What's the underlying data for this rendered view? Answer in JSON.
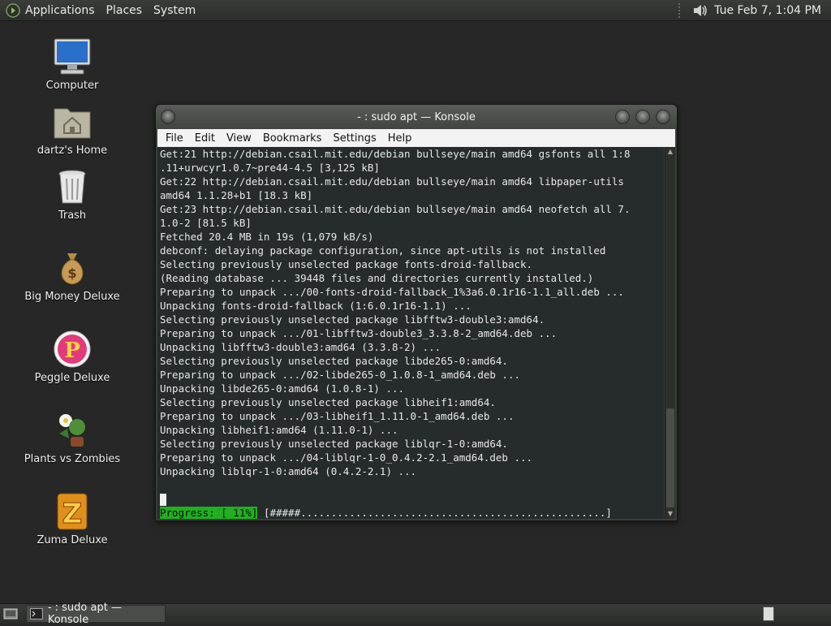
{
  "top_panel": {
    "menus": [
      "Applications",
      "Places",
      "System"
    ],
    "clock": "Tue Feb  7,  1:04 PM"
  },
  "desktop": {
    "icons": [
      {
        "label": "Computer",
        "icon": "computer-icon"
      },
      {
        "label": "dartz's Home",
        "icon": "home-folder-icon"
      },
      {
        "label": "Trash",
        "icon": "trash-icon"
      },
      {
        "label": "Big Money Deluxe",
        "icon": "money-bag-icon"
      },
      {
        "label": "Peggle Deluxe",
        "icon": "peggle-icon"
      },
      {
        "label": "Plants vs Zombies",
        "icon": "plants-vs-zombies-icon"
      },
      {
        "label": "Zuma Deluxe",
        "icon": "zuma-icon"
      }
    ]
  },
  "window": {
    "title": "- : sudo apt — Konsole",
    "menu": [
      "File",
      "Edit",
      "View",
      "Bookmarks",
      "Settings",
      "Help"
    ]
  },
  "terminal": {
    "lines": [
      "Get:21 http://debian.csail.mit.edu/debian bullseye/main amd64 gsfonts all 1:8",
      ".11+urwcyr1.0.7~pre44-4.5 [3,125 kB]",
      "Get:22 http://debian.csail.mit.edu/debian bullseye/main amd64 libpaper-utils",
      "amd64 1.1.28+b1 [18.3 kB]",
      "Get:23 http://debian.csail.mit.edu/debian bullseye/main amd64 neofetch all 7.",
      "1.0-2 [81.5 kB]",
      "Fetched 20.4 MB in 19s (1,079 kB/s)",
      "debconf: delaying package configuration, since apt-utils is not installed",
      "Selecting previously unselected package fonts-droid-fallback.",
      "(Reading database ... 39448 files and directories currently installed.)",
      "Preparing to unpack .../00-fonts-droid-fallback_1%3a6.0.1r16-1.1_all.deb ...",
      "Unpacking fonts-droid-fallback (1:6.0.1r16-1.1) ...",
      "Selecting previously unselected package libfftw3-double3:amd64.",
      "Preparing to unpack .../01-libfftw3-double3_3.3.8-2_amd64.deb ...",
      "Unpacking libfftw3-double3:amd64 (3.3.8-2) ...",
      "Selecting previously unselected package libde265-0:amd64.",
      "Preparing to unpack .../02-libde265-0_1.0.8-1_amd64.deb ...",
      "Unpacking libde265-0:amd64 (1.0.8-1) ...",
      "Selecting previously unselected package libheif1:amd64.",
      "Preparing to unpack .../03-libheif1_1.11.0-1_amd64.deb ...",
      "Unpacking libheif1:amd64 (1.11.0-1) ...",
      "Selecting previously unselected package liblqr-1-0:amd64.",
      "Preparing to unpack .../04-liblqr-1-0_0.4.2-2.1_amd64.deb ...",
      "Unpacking liblqr-1-0:amd64 (0.4.2-2.1) ..."
    ],
    "progress_label": "Progress: [ 11%]",
    "progress_bar": " [#####..................................................]"
  },
  "taskbar": {
    "task_label": "- : sudo apt — Konsole"
  }
}
